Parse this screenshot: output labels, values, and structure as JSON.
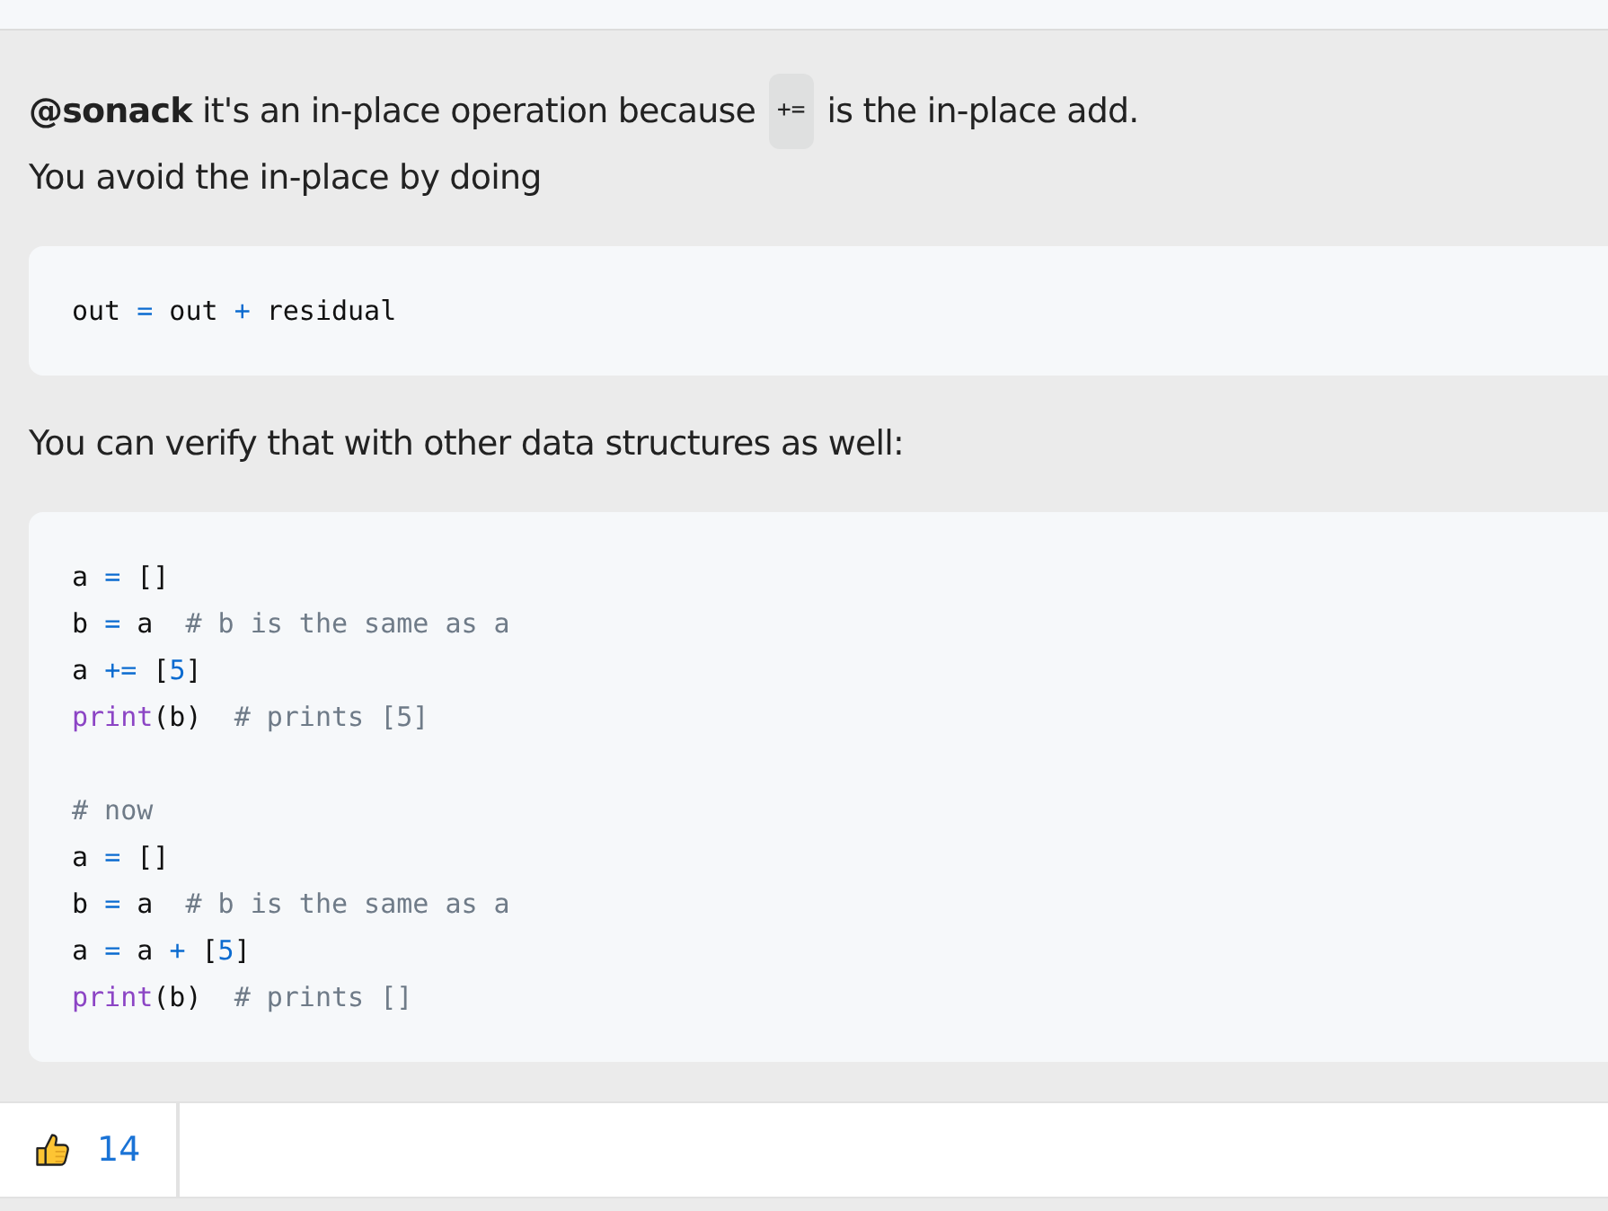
{
  "post": {
    "paragraphs": [
      {
        "parts": [
          {
            "kind": "mention",
            "text": "@sonack"
          },
          {
            "kind": "text",
            "text": " it's an in-place operation because"
          },
          {
            "kind": "code",
            "text": "+="
          },
          {
            "kind": "text",
            "text": "is the in-place add."
          }
        ]
      },
      {
        "parts": [
          {
            "kind": "text",
            "text": "You avoid the in-place by doing"
          }
        ]
      }
    ],
    "code_blocks": [
      {
        "lines": [
          {
            "kind": "code",
            "tokens": [
              {
                "kind": "name",
                "text": "out "
              },
              {
                "kind": "op",
                "text": "="
              },
              {
                "kind": "name",
                "text": " out "
              },
              {
                "kind": "op",
                "text": "+"
              },
              {
                "kind": "name",
                "text": " residual"
              }
            ]
          }
        ]
      },
      {
        "lines": [
          {
            "kind": "code",
            "tokens": [
              {
                "kind": "name",
                "text": "a "
              },
              {
                "kind": "op",
                "text": "="
              },
              {
                "kind": "name",
                "text": " []"
              }
            ]
          },
          {
            "kind": "code",
            "tokens": [
              {
                "kind": "name",
                "text": "b "
              },
              {
                "kind": "op",
                "text": "="
              },
              {
                "kind": "name",
                "text": " a  "
              },
              {
                "kind": "comment",
                "text": "# b is the same as a"
              }
            ]
          },
          {
            "kind": "code",
            "tokens": [
              {
                "kind": "name",
                "text": "a "
              },
              {
                "kind": "op",
                "text": "+="
              },
              {
                "kind": "name",
                "text": " ["
              },
              {
                "kind": "number",
                "text": "5"
              },
              {
                "kind": "name",
                "text": "]"
              }
            ]
          },
          {
            "kind": "code",
            "tokens": [
              {
                "kind": "builtin",
                "text": "print"
              },
              {
                "kind": "name",
                "text": "(b)  "
              },
              {
                "kind": "comment",
                "text": "# prints [5]"
              }
            ]
          },
          {
            "kind": "blank"
          },
          {
            "kind": "code",
            "tokens": [
              {
                "kind": "comment",
                "text": "# now"
              }
            ]
          },
          {
            "kind": "code",
            "tokens": [
              {
                "kind": "name",
                "text": "a "
              },
              {
                "kind": "op",
                "text": "="
              },
              {
                "kind": "name",
                "text": " []"
              }
            ]
          },
          {
            "kind": "code",
            "tokens": [
              {
                "kind": "name",
                "text": "b "
              },
              {
                "kind": "op",
                "text": "="
              },
              {
                "kind": "name",
                "text": " a  "
              },
              {
                "kind": "comment",
                "text": "# b is the same as a"
              }
            ]
          },
          {
            "kind": "code",
            "tokens": [
              {
                "kind": "name",
                "text": "a "
              },
              {
                "kind": "op",
                "text": "="
              },
              {
                "kind": "name",
                "text": " a "
              },
              {
                "kind": "op",
                "text": "+"
              },
              {
                "kind": "name",
                "text": " ["
              },
              {
                "kind": "number",
                "text": "5"
              },
              {
                "kind": "name",
                "text": "]"
              }
            ]
          },
          {
            "kind": "code",
            "tokens": [
              {
                "kind": "builtin",
                "text": "print"
              },
              {
                "kind": "name",
                "text": "(b)  "
              },
              {
                "kind": "comment",
                "text": "# prints []"
              }
            ]
          }
        ]
      }
    ],
    "middle_text": "You can verify that with other data structures as well:"
  },
  "reactions": {
    "likes": "14"
  }
}
